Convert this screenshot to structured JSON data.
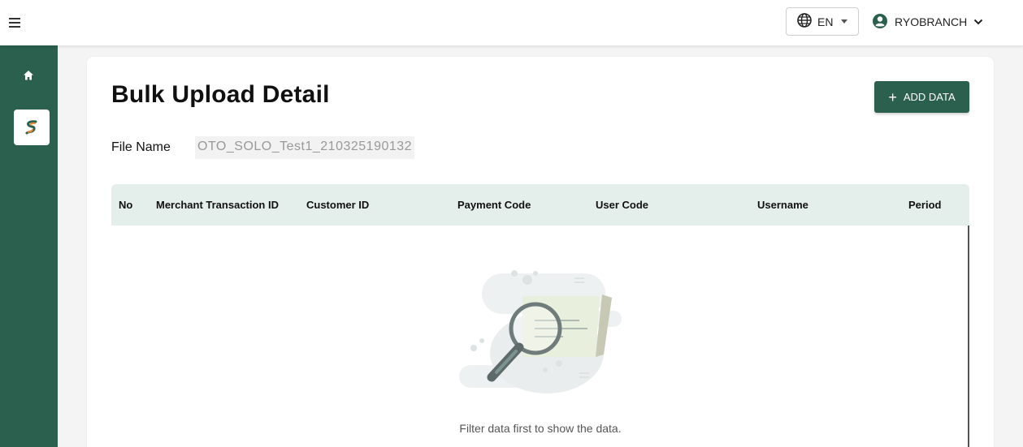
{
  "header": {
    "language": "EN",
    "username": "RYOBRANCH"
  },
  "page": {
    "title": "Bulk Upload Detail",
    "add_button_label": "ADD DATA",
    "file_name_label": "File Name",
    "file_name_value": "OTO_SOLO_Test1_210325190132"
  },
  "table": {
    "columns": [
      "No",
      "Merchant Transaction ID",
      "Customer ID",
      "Payment Code",
      "User Code",
      "Username",
      "Period"
    ],
    "empty_message": "Filter data first to show the data."
  },
  "colors": {
    "brand": "#2b5f4e",
    "table_header": "#e4eeeb"
  },
  "icons": {
    "menu": "hamburger-menu-icon",
    "language": "globe-icon",
    "user": "account-circle-icon",
    "home": "home-icon",
    "app": "app-logo-icon"
  }
}
